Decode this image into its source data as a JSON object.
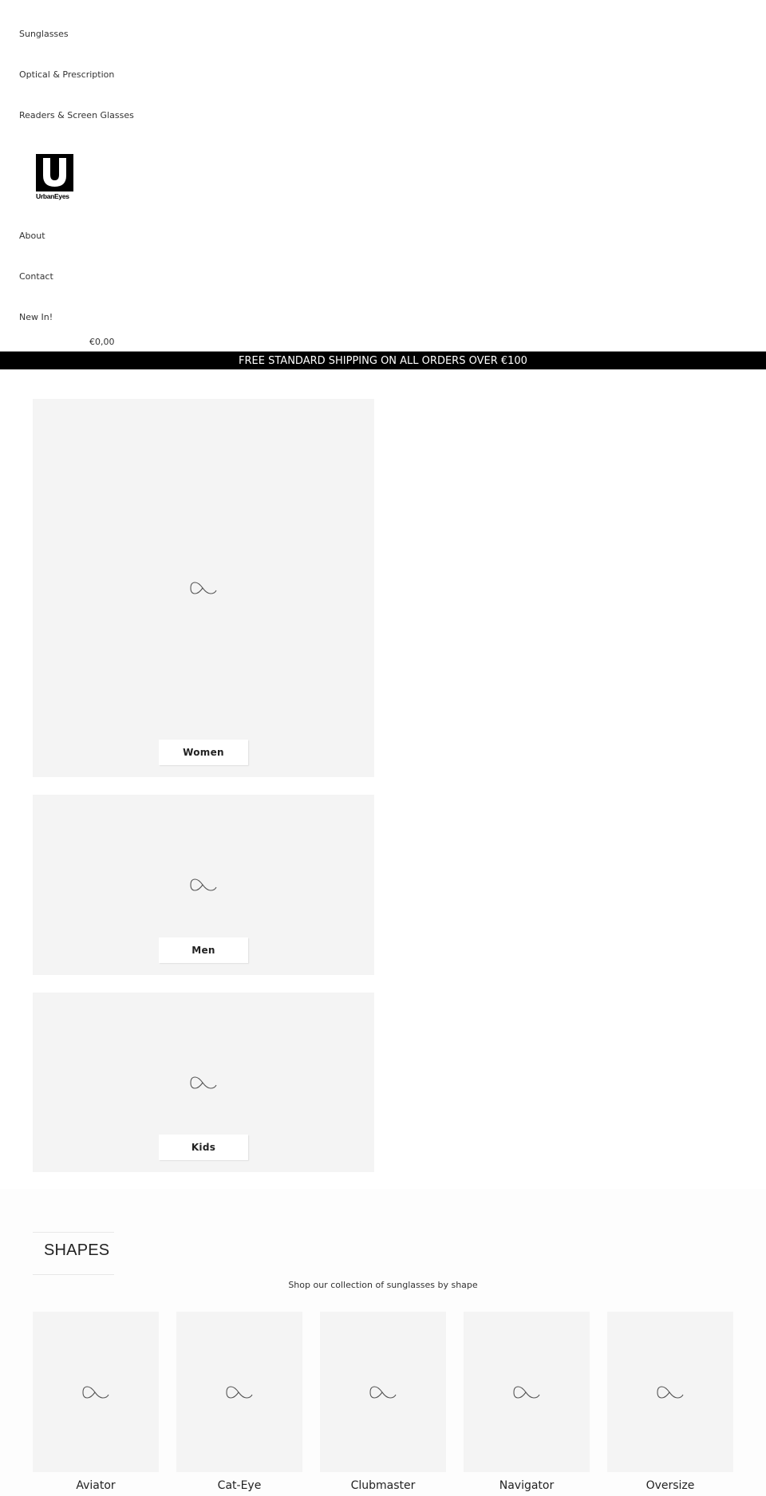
{
  "nav": {
    "items": [
      {
        "label": "Sunglasses"
      },
      {
        "label": "Optical & Prescription"
      },
      {
        "label": "Readers & Screen Glasses"
      },
      {
        "label": "About"
      },
      {
        "label": "Contact"
      },
      {
        "label": "New In!"
      }
    ],
    "logo": {
      "letter": "U",
      "text": "UrbanEyes"
    },
    "cart_total": "€0,00"
  },
  "banner": {
    "text": "FREE STANDARD SHIPPING ON ALL ORDERS OVER €100"
  },
  "categories": [
    {
      "label": "Women",
      "icon": "image-placeholder-icon"
    },
    {
      "label": "Men",
      "icon": "image-placeholder-icon"
    },
    {
      "label": "Kids",
      "icon": "image-placeholder-icon"
    }
  ],
  "shapes": {
    "heading": "SHAPES",
    "subtitle": "Shop our collection of sunglasses by shape",
    "items": [
      {
        "label": "Aviator"
      },
      {
        "label": "Cat-Eye"
      },
      {
        "label": "Clubmaster"
      },
      {
        "label": "Navigator"
      },
      {
        "label": "Oversize"
      }
    ]
  },
  "colors": {
    "banner_bg": "#000000",
    "card_bg": "#f4f4f4",
    "text": "#333333"
  }
}
